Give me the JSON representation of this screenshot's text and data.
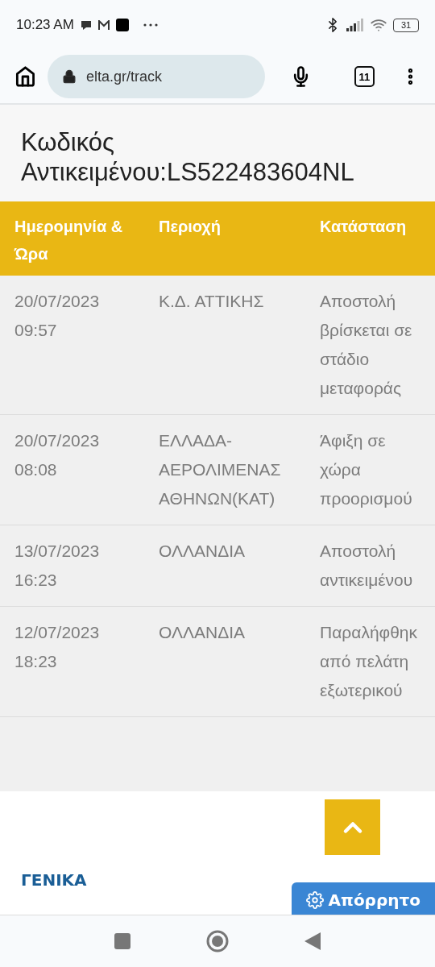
{
  "status_bar": {
    "time": "10:23 AM",
    "battery": "31"
  },
  "browser": {
    "url": "elta.gr/track",
    "tab_count": "11"
  },
  "title": "Κωδικός Αντικειμένου:LS522483604NL",
  "table": {
    "columns": [
      "Ημερομηνία & Ώρα",
      "Περιοχή",
      "Κατάσταση"
    ],
    "rows": [
      {
        "date": "20/07/2023 09:57",
        "area": "Κ.Δ. ΑΤΤΙΚΗΣ",
        "status": "Αποστολή βρίσκεται σε στάδιο μεταφοράς"
      },
      {
        "date": "20/07/2023 08:08",
        "area": "ΕΛΛΑΔΑ-ΑΕΡΟΛΙΜΕΝΑΣ ΑΘΗΝΩΝ(ΚΑΤ)",
        "status": "Άφιξη σε χώρα προορισμού"
      },
      {
        "date": "13/07/2023 16:23",
        "area": "ΟΛΛΑΝΔΙΑ",
        "status": "Αποστολή αντικειμένου"
      },
      {
        "date": "12/07/2023 18:23",
        "area": "ΟΛΛΑΝΔΙΑ",
        "status": "Παραλήφθηκ από πελάτη εξωτερικού"
      }
    ]
  },
  "footer": {
    "heading": "ΓΕΝΙΚΑ",
    "privacy_button": "Απόρρητο"
  }
}
